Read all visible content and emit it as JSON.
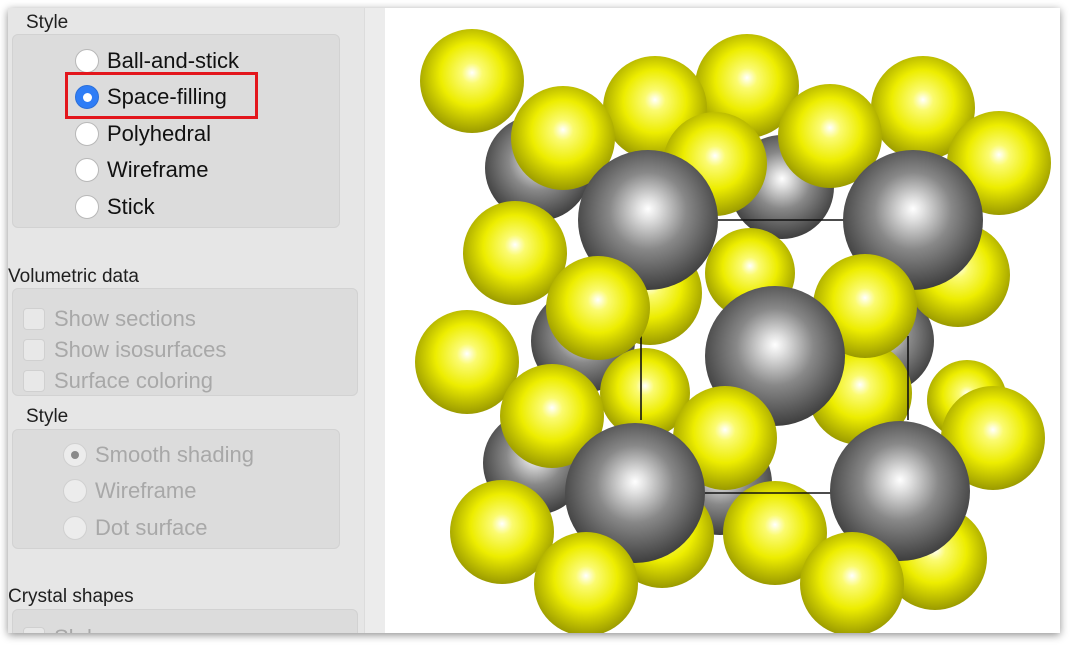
{
  "sidebar": {
    "style_label": "Style",
    "style_options": [
      {
        "label": "Ball-and-stick",
        "selected": false
      },
      {
        "label": "Space-filling",
        "selected": true
      },
      {
        "label": "Polyhedral",
        "selected": false
      },
      {
        "label": "Wireframe",
        "selected": false
      },
      {
        "label": "Stick",
        "selected": false
      }
    ],
    "volumetric_label": "Volumetric data",
    "volumetric_checks": [
      {
        "label": "Show sections",
        "checked": false,
        "enabled": false
      },
      {
        "label": "Show isosurfaces",
        "checked": false,
        "enabled": false
      },
      {
        "label": "Surface coloring",
        "checked": false,
        "enabled": false
      }
    ],
    "vol_style_label": "Style",
    "vol_style_options": [
      {
        "label": "Smooth shading",
        "selected": true,
        "enabled": false
      },
      {
        "label": "Wireframe",
        "selected": false,
        "enabled": false
      },
      {
        "label": "Dot surface",
        "selected": false,
        "enabled": false
      }
    ],
    "crystal_label": "Crystal shapes",
    "crystal_partial_text": "Sh   l"
  },
  "viewer": {
    "atom_colors": {
      "sulfur": "#f0f000",
      "metal": "#8c8c8c"
    },
    "highlight_color": "#e3161c",
    "accent": "#2f7df6"
  }
}
